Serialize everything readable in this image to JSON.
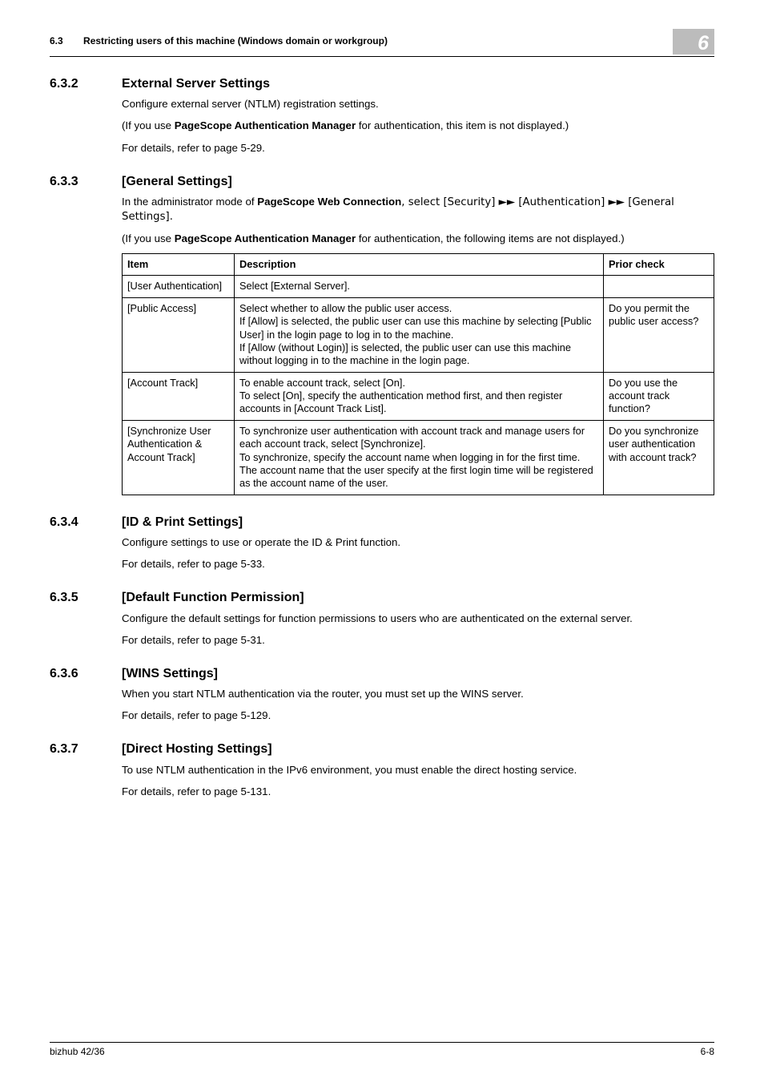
{
  "header": {
    "section_no": "6.3",
    "section_title": "Restricting users of this machine (Windows domain or workgroup)",
    "chapter": "6"
  },
  "s632": {
    "num": "6.3.2",
    "title": "External Server Settings",
    "p1": "Configure external server (NTLM) registration settings.",
    "p2a": "(If you use ",
    "p2b": "PageScope Authentication Manager",
    "p2c": " for authentication, this item is not displayed.)",
    "p3": "For details, refer to page 5-29."
  },
  "s633": {
    "num": "6.3.3",
    "title": "[General Settings]",
    "p1a": "In the administrator mode of ",
    "p1b": "PageScope Web Connection",
    "p1c": ", select [Security] ►► [Authentication] ►► [General Settings].",
    "p2a": "(If you use ",
    "p2b": "PageScope Authentication Manager",
    "p2c": " for authentication, the following items are not displayed.)",
    "table": {
      "h1": "Item",
      "h2": "Description",
      "h3": "Prior check",
      "rows": [
        {
          "item": "[User Authentication]",
          "desc": "Select [External Server].",
          "prior": ""
        },
        {
          "item": "[Public Access]",
          "desc": "Select whether to allow the public user access.\nIf [Allow] is selected, the public user can use this machine by selecting [Public User] in the login page to log in to the machine.\nIf [Allow (without Login)] is selected, the public user can use this machine without logging in to the machine in the login page.",
          "prior": "Do you permit the public user access?"
        },
        {
          "item": "[Account Track]",
          "desc": "To enable account track, select [On].\nTo select [On], specify the authentication method first, and then register accounts in [Account Track List].",
          "prior": "Do you use the account track function?"
        },
        {
          "item": "[Synchronize User Authentication & Account Track]",
          "desc": "To synchronize user authentication with account track and manage users for each account track, select [Synchronize].\nTo synchronize, specify the account name when logging in for the first time. The account name that the user specify at the first login time will be registered as the account name of the user.",
          "prior": "Do you synchronize user authentication with account track?"
        }
      ]
    }
  },
  "s634": {
    "num": "6.3.4",
    "title": "[ID & Print Settings]",
    "p1": "Configure settings to use or operate the ID & Print function.",
    "p2": "For details, refer to page 5-33."
  },
  "s635": {
    "num": "6.3.5",
    "title": "[Default Function Permission]",
    "p1": "Configure the default settings for function permissions to users who are authenticated on the external server.",
    "p2": "For details, refer to page 5-31."
  },
  "s636": {
    "num": "6.3.6",
    "title": "[WINS Settings]",
    "p1": "When you start NTLM authentication via the router, you must set up the WINS server.",
    "p2": "For details, refer to page 5-129."
  },
  "s637": {
    "num": "6.3.7",
    "title": "[Direct Hosting Settings]",
    "p1": "To use NTLM authentication in the IPv6 environment, you must enable the direct hosting service.",
    "p2": "For details, refer to page 5-131."
  },
  "footer": {
    "left": "bizhub 42/36",
    "right": "6-8"
  }
}
